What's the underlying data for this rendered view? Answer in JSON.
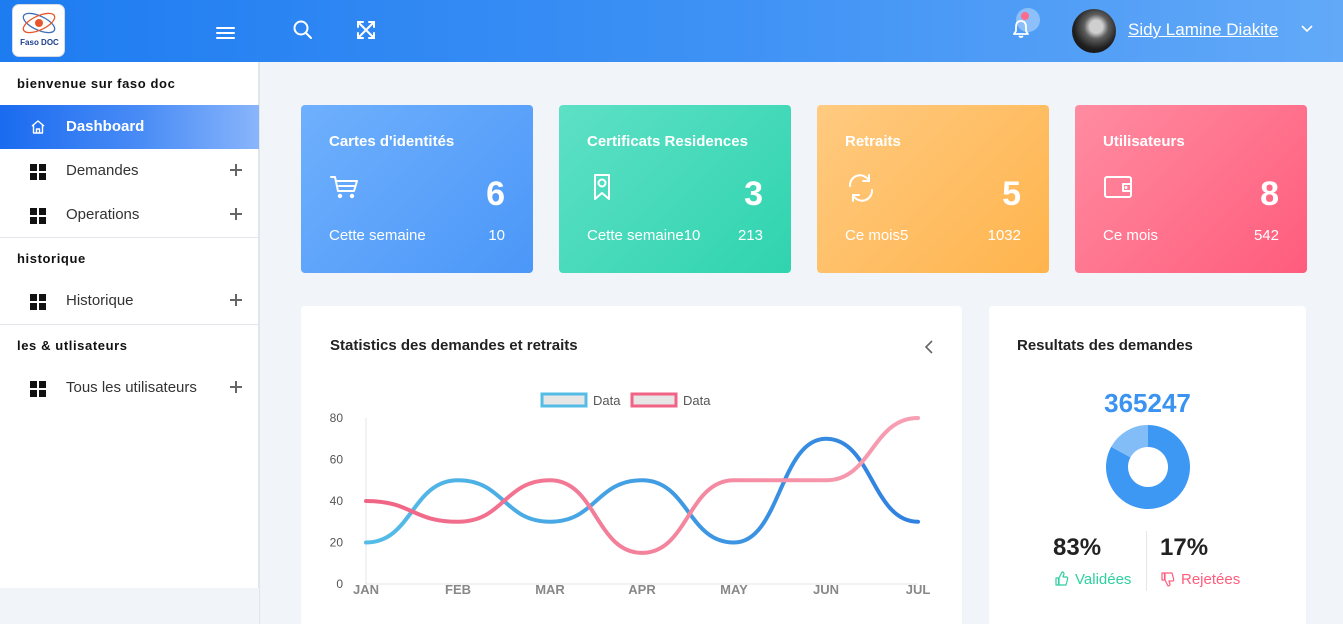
{
  "header": {
    "logo_text": "Faso DOC",
    "username": "Sidy Lamine Diakite"
  },
  "sidebar": {
    "sections": [
      {
        "title": "bienvenue sur faso doc"
      },
      {
        "title": "historique"
      },
      {
        "title": "les & utlisateurs"
      }
    ],
    "items": [
      {
        "label": "Dashboard",
        "icon": "home-icon",
        "active": true
      },
      {
        "label": "Demandes",
        "icon": "grid-icon"
      },
      {
        "label": "Operations",
        "icon": "grid-icon"
      },
      {
        "label": "Historique",
        "icon": "grid-icon"
      },
      {
        "label": "Tous les utilisateurs",
        "icon": "grid-icon"
      }
    ]
  },
  "cards": [
    {
      "title": "Cartes d'identités",
      "number": "6",
      "sub": "Cette semaine",
      "value": "10",
      "icon": "cart-icon",
      "color": "#4b97f8"
    },
    {
      "title": "Certificats Residences",
      "number": "3",
      "sub": "Cette semaine10",
      "value": "213",
      "icon": "ribbon-icon",
      "color": "#2fd4ae"
    },
    {
      "title": "Retraits",
      "number": "5",
      "sub": "Ce mois5",
      "value": "1032",
      "icon": "refresh-icon",
      "color": "#ffb44d"
    },
    {
      "title": "Utilisateurs",
      "number": "8",
      "sub": "Ce mois",
      "value": "542",
      "icon": "wallet-icon",
      "color": "#ff5c7c"
    }
  ],
  "statistics_panel": {
    "title": "Statistics des demandes et retraits"
  },
  "results_panel": {
    "title": "Resultats des demandes",
    "total": "365247",
    "validated_pct": "83%",
    "validated_label": "Validées",
    "rejected_pct": "17%",
    "rejected_label": "Rejetées",
    "donut": [
      {
        "value": 83,
        "color": "#3d98f3"
      },
      {
        "value": 17,
        "color": "#82bdf8"
      }
    ]
  },
  "chart_data": {
    "type": "line",
    "categories": [
      "JAN",
      "FEB",
      "MAR",
      "APR",
      "MAY",
      "JUN",
      "JUL"
    ],
    "ylim": [
      0,
      80
    ],
    "yticks": [
      0,
      20,
      40,
      60,
      80
    ],
    "series": [
      {
        "name": "Data",
        "values": [
          20,
          50,
          30,
          50,
          20,
          70,
          30
        ],
        "color": "#55bce6",
        "fill": "#e6e6e6",
        "end_color": "#2f80e0"
      },
      {
        "name": "Data",
        "values": [
          40,
          30,
          50,
          15,
          50,
          50,
          80
        ],
        "color": "#f06384",
        "fill": "#e6e6e6",
        "end_color": "#f7a0b3"
      }
    ]
  }
}
